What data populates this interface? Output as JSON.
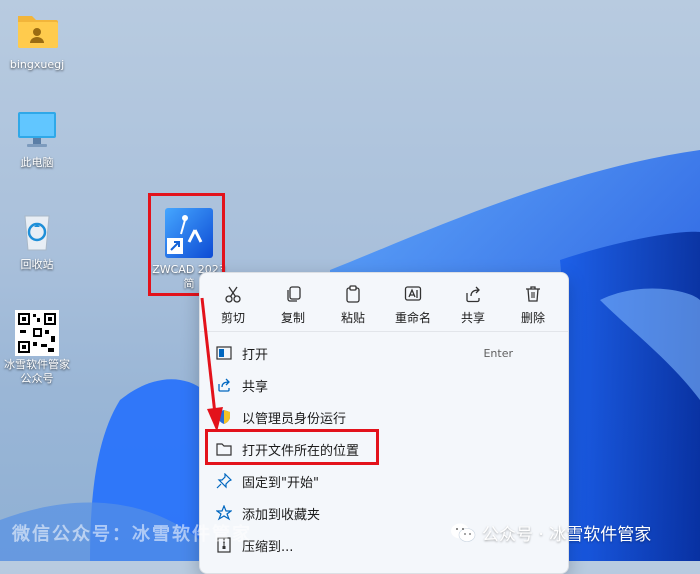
{
  "desktop": {
    "icons": [
      {
        "label": "bingxuegj"
      },
      {
        "label": "此电脑"
      },
      {
        "label": "回收站"
      },
      {
        "label": "冰雪软件管家公众号"
      },
      {
        "label": "ZWCAD 2023 简"
      }
    ]
  },
  "context_menu": {
    "top_actions": [
      {
        "label": "剪切",
        "icon": "cut-icon"
      },
      {
        "label": "复制",
        "icon": "copy-icon"
      },
      {
        "label": "粘贴",
        "icon": "paste-icon"
      },
      {
        "label": "重命名",
        "icon": "rename-icon"
      },
      {
        "label": "共享",
        "icon": "share-icon"
      },
      {
        "label": "删除",
        "icon": "delete-icon"
      }
    ],
    "items": [
      {
        "label": "打开",
        "shortcut": "Enter",
        "icon": "open-icon"
      },
      {
        "label": "共享",
        "icon": "share-icon"
      },
      {
        "label": "以管理员身份运行",
        "icon": "shield-icon"
      },
      {
        "label": "打开文件所在的位置",
        "icon": "folder-icon"
      },
      {
        "label": "固定到\"开始\"",
        "icon": "pin-icon"
      },
      {
        "label": "添加到收藏夹",
        "icon": "star-icon"
      },
      {
        "label": "压缩到...",
        "icon": "zip-icon"
      }
    ]
  },
  "watermark": {
    "left": "微信公众号：冰雪软件管家",
    "right": "公众号 · 冰雪软件管家"
  },
  "colors": {
    "highlight": "#e3121b",
    "accent": "#0067c0"
  }
}
